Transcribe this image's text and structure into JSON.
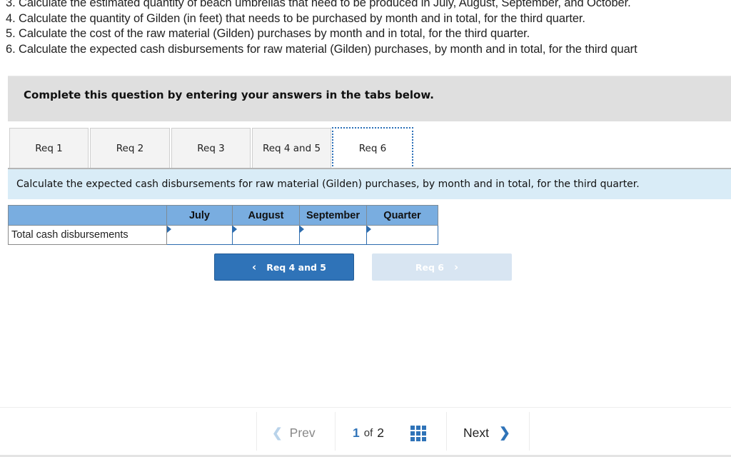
{
  "instructions": [
    "3. Calculate the estimated quantity of beach umbrellas that need to be produced in July, August, September, and October.",
    "4. Calculate the quantity of Gilden (in feet) that needs to be purchased by month and in total, for the third quarter.",
    "5. Calculate the cost of the raw material (Gilden) purchases by month and in total, for the third quarter.",
    "6. Calculate the expected cash disbursements for raw material (Gilden) purchases, by month and in total, for the third quart"
  ],
  "banner": {
    "text": "Complete this question by entering your answers in the tabs below."
  },
  "tabs": [
    {
      "label": "Req 1",
      "active": false
    },
    {
      "label": "Req 2",
      "active": false
    },
    {
      "label": "Req 3",
      "active": false
    },
    {
      "label": "Req 4 and 5",
      "active": true
    },
    {
      "label": "Req 6",
      "active": true
    }
  ],
  "active_tab": "Req 6",
  "prompt": "Calculate the expected cash disbursements for raw material (Gilden) purchases, by month and in total, for the third quarter.",
  "table": {
    "headers": [
      "",
      "July",
      "August",
      "September",
      "Quarter"
    ],
    "rows": [
      {
        "label": "Total cash disbursements",
        "values": [
          "",
          "",
          "",
          ""
        ]
      }
    ]
  },
  "nav_buttons": {
    "prev_label": "Req 4 and 5",
    "next_label": "Req 6",
    "prev_chevron": "‹",
    "next_chevron": "›"
  },
  "pager": {
    "prev_label": "Prev",
    "current": "1",
    "of_label": "of",
    "total": "2",
    "next_label": "Next"
  },
  "colors": {
    "accent": "#2f73b8",
    "header_blue": "#79ade0",
    "prompt_bg": "#d9ecf7",
    "banner_bg": "#dfdfdf"
  }
}
